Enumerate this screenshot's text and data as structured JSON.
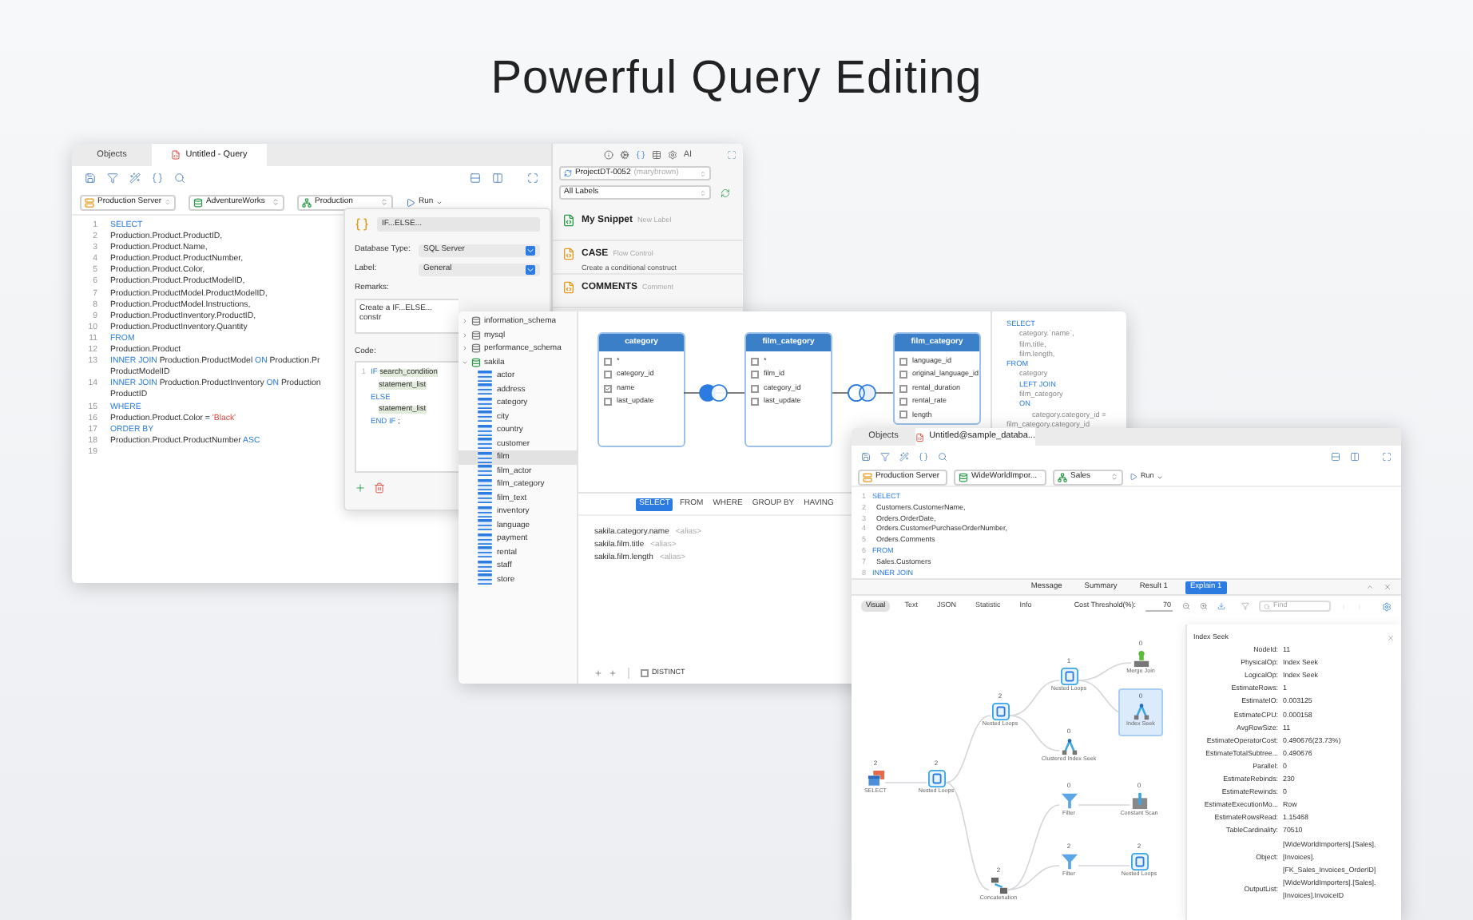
{
  "headline": "Powerful Query Editing",
  "query_window": {
    "tabs": [
      {
        "label": "Objects",
        "kind": "objects",
        "selected": false
      },
      {
        "label": "Untitled - Query",
        "kind": "query",
        "selected": true
      }
    ],
    "connection_selects": [
      {
        "kind": "server",
        "value": "Production Server"
      },
      {
        "kind": "database",
        "value": "AdventureWorks"
      },
      {
        "kind": "schema",
        "value": "Production"
      }
    ],
    "run_button": "Run",
    "code_lines": [
      {
        "number": "1",
        "tokens": [
          {
            "kind": "kw",
            "text": "SELECT"
          }
        ]
      },
      {
        "number": "2",
        "tokens": [
          {
            "kind": "plain",
            "text": "Production.Product.ProductID,"
          }
        ]
      },
      {
        "number": "3",
        "tokens": [
          {
            "kind": "plain",
            "text": "Production.Product.Name,"
          }
        ]
      },
      {
        "number": "4",
        "tokens": [
          {
            "kind": "plain",
            "text": "Production.Product.ProductNumber,"
          }
        ]
      },
      {
        "number": "5",
        "tokens": [
          {
            "kind": "plain",
            "text": "Production.Product.Color,"
          }
        ]
      },
      {
        "number": "6",
        "tokens": [
          {
            "kind": "plain",
            "text": "Production.Product.ProductModelID,"
          }
        ]
      },
      {
        "number": "7",
        "tokens": [
          {
            "kind": "plain",
            "text": "Production.ProductModel.ProductModelID,"
          }
        ]
      },
      {
        "number": "8",
        "tokens": [
          {
            "kind": "plain",
            "text": "Production.ProductModel.Instructions,"
          }
        ]
      },
      {
        "number": "9",
        "tokens": [
          {
            "kind": "plain",
            "text": "Production.ProductInventory.ProductID,"
          }
        ]
      },
      {
        "number": "10",
        "tokens": [
          {
            "kind": "plain",
            "text": "Production.ProductInventory.Quantity"
          }
        ]
      },
      {
        "number": "11",
        "tokens": [
          {
            "kind": "kw",
            "text": "FROM"
          }
        ]
      },
      {
        "number": "12",
        "tokens": [
          {
            "kind": "plain",
            "text": "Production.Product"
          }
        ]
      },
      {
        "number": "13",
        "tokens": [
          {
            "kind": "kw",
            "text": "INNER JOIN"
          },
          {
            "kind": "plain",
            "text": " Production.ProductModel "
          },
          {
            "kind": "kw",
            "text": "ON"
          },
          {
            "kind": "plain",
            "text": " Production.Pr"
          }
        ]
      },
      {
        "tokens": [
          {
            "kind": "plain",
            "text": "ProductModelID"
          }
        ]
      },
      {
        "number": "14",
        "tokens": [
          {
            "kind": "kw",
            "text": "INNER JOIN"
          },
          {
            "kind": "plain",
            "text": " Production.ProductInventory "
          },
          {
            "kind": "kw",
            "text": "ON"
          },
          {
            "kind": "plain",
            "text": " Production"
          }
        ]
      },
      {
        "tokens": [
          {
            "kind": "plain",
            "text": "ProductID"
          }
        ]
      },
      {
        "number": "15",
        "tokens": [
          {
            "kind": "kw",
            "text": "WHERE"
          }
        ]
      },
      {
        "number": "16",
        "tokens": [
          {
            "kind": "plain",
            "text": "Production.Product.Color = "
          },
          {
            "kind": "str",
            "text": "'Black'"
          }
        ]
      },
      {
        "number": "17",
        "tokens": [
          {
            "kind": "kw",
            "text": "ORDER BY"
          }
        ]
      },
      {
        "number": "18",
        "tokens": [
          {
            "kind": "plain",
            "text": "Production.Product.ProductNumber "
          },
          {
            "kind": "kw",
            "text": "ASC"
          }
        ]
      },
      {
        "number": "19"
      }
    ],
    "snippet_editor": {
      "title": "IF...ELSE...",
      "fields": [
        {
          "label": "Database Type:",
          "value": "SQL Server"
        },
        {
          "label": "Label:",
          "value": "General"
        }
      ],
      "remarks_label": "Remarks:",
      "remarks": "Create a IF...ELSE... constr",
      "code_label": "Code:",
      "code_lines": [
        {
          "number": "1",
          "kind": "block",
          "tokens": [
            {
              "kind": "kw",
              "text": "IF "
            },
            {
              "kind": "ph",
              "text": "search_condition"
            }
          ]
        },
        {
          "kind": "nested",
          "tokens": [
            {
              "kind": "ph",
              "text": "statement_list"
            }
          ]
        },
        {
          "kind": "block",
          "tokens": [
            {
              "kind": "kw",
              "text": "ELSE"
            }
          ]
        },
        {
          "kind": "nested",
          "tokens": [
            {
              "kind": "ph",
              "text": "statement_list"
            }
          ]
        },
        {
          "kind": "block",
          "tokens": [
            {
              "kind": "kw",
              "text": "END IF"
            },
            {
              "kind": "plain",
              "text": " ;"
            }
          ]
        }
      ]
    },
    "snippet_panel": {
      "ai_label": "AI",
      "project": "ProjectDT-0052",
      "owner": "(marybrown)",
      "label_filter": "All Labels",
      "snippets": [
        {
          "name": "My Snippet",
          "tag": "New Label",
          "kind": "mine"
        },
        {
          "name": "CASE",
          "tag": "Flow Control",
          "description": "Create a conditional construct",
          "kind": "builtin"
        },
        {
          "name": "COMMENTS",
          "tag": "Comment",
          "kind": "builtin"
        }
      ]
    }
  },
  "query_builder": {
    "tree": [
      {
        "name": "information_schema",
        "expanded": false
      },
      {
        "name": "mysql",
        "expanded": false
      },
      {
        "name": "performance_schema",
        "expanded": false
      },
      {
        "name": "sakila",
        "expanded": true,
        "children": [
          {
            "name": "actor",
            "selected": false
          },
          {
            "name": "address",
            "selected": false
          },
          {
            "name": "category",
            "selected": false
          },
          {
            "name": "city",
            "selected": false
          },
          {
            "name": "country",
            "selected": false
          },
          {
            "name": "customer",
            "selected": false
          },
          {
            "name": "film",
            "selected": true
          },
          {
            "name": "film_actor",
            "selected": false
          },
          {
            "name": "film_category",
            "selected": false
          },
          {
            "name": "film_text",
            "selected": false
          },
          {
            "name": "inventory",
            "selected": false
          },
          {
            "name": "language",
            "selected": false
          },
          {
            "name": "payment",
            "selected": false
          },
          {
            "name": "rental",
            "selected": false
          },
          {
            "name": "staff",
            "selected": false
          },
          {
            "name": "store",
            "selected": false
          }
        ]
      }
    ],
    "tables": [
      {
        "name": "category",
        "columns": [
          {
            "name": "*",
            "checked": false
          },
          {
            "name": "category_id",
            "checked": false
          },
          {
            "name": "name",
            "checked": true
          },
          {
            "name": "last_update",
            "checked": false
          }
        ]
      },
      {
        "name": "film_category",
        "columns": [
          {
            "name": "*",
            "checked": false
          },
          {
            "name": "film_id",
            "checked": false
          },
          {
            "name": "category_id",
            "checked": false
          },
          {
            "name": "last_update",
            "checked": false
          }
        ]
      },
      {
        "name": "film_category",
        "columns": [
          {
            "name": "language_id",
            "checked": false
          },
          {
            "name": "original_language_id",
            "checked": false
          },
          {
            "name": "rental_duration",
            "checked": false
          },
          {
            "name": "rental_rate",
            "checked": false
          },
          {
            "name": "length",
            "checked": false
          }
        ]
      }
    ],
    "joins": [
      {
        "kind": "left"
      },
      {
        "kind": "inner"
      }
    ],
    "clause_tabs": [
      {
        "label": "SELECT",
        "selected": true
      },
      {
        "label": "FROM",
        "selected": false
      },
      {
        "label": "WHERE",
        "selected": false
      },
      {
        "label": "GROUP BY",
        "selected": false
      },
      {
        "label": "HAVING",
        "selected": false
      }
    ],
    "fields": [
      {
        "name": "sakila.category.name",
        "alias": "<alias>"
      },
      {
        "name": "sakila.film.title",
        "alias": "<alias>"
      },
      {
        "name": "sakila.film.length",
        "alias": "<alias>"
      }
    ],
    "distinct": {
      "label": "DISTINCT",
      "checked": false
    },
    "sql_preview": [
      {
        "kind": "kw",
        "text": "SELECT"
      },
      {
        "kind": "col",
        "text": "category.`name`,"
      },
      {
        "kind": "col",
        "text": "film.title,"
      },
      {
        "kind": "col",
        "text": "film.length,"
      },
      {
        "kind": "kw",
        "text": "FROM"
      },
      {
        "kind": "col",
        "text": "category"
      },
      {
        "kind": "kwi",
        "text": "LEFT JOIN"
      },
      {
        "kind": "col",
        "text": "film_category"
      },
      {
        "kind": "kwi",
        "text": "ON"
      },
      {
        "kind": "cond",
        "text": "category.category_id = film_category.category_id"
      }
    ]
  },
  "explain_window": {
    "tabs": [
      {
        "label": "Objects",
        "kind": "objects",
        "selected": false
      },
      {
        "label": "Untitled@sample_databa...",
        "kind": "query",
        "selected": true
      }
    ],
    "connection_selects": [
      {
        "kind": "server",
        "value": "Production Server"
      },
      {
        "kind": "database",
        "value": "WideWorldImpor..."
      },
      {
        "kind": "schema",
        "value": "Sales"
      }
    ],
    "run_button": "Run",
    "code_lines": [
      {
        "number": "1",
        "tokens": [
          {
            "kind": "kw",
            "text": "SELECT"
          }
        ]
      },
      {
        "number": "2",
        "tokens": [
          {
            "kind": "plain",
            "text": "  Customers.CustomerName,"
          }
        ]
      },
      {
        "number": "3",
        "tokens": [
          {
            "kind": "plain",
            "text": "  Orders.OrderDate,"
          }
        ]
      },
      {
        "number": "4",
        "tokens": [
          {
            "kind": "plain",
            "text": "  Orders.CustomerPurchaseOrderNumber,"
          }
        ]
      },
      {
        "number": "5",
        "tokens": [
          {
            "kind": "plain",
            "text": "  Orders.Comments"
          }
        ]
      },
      {
        "number": "6",
        "tokens": [
          {
            "kind": "kw",
            "text": "FROM"
          }
        ]
      },
      {
        "number": "7",
        "tokens": [
          {
            "kind": "plain",
            "text": "  Sales.Customers"
          }
        ]
      },
      {
        "number": "8",
        "tokens": [
          {
            "kind": "kw",
            "text": "INNER JOIN"
          }
        ]
      }
    ],
    "result_tabs": [
      {
        "label": "Message",
        "selected": false
      },
      {
        "label": "Summary",
        "selected": false
      },
      {
        "label": "Result 1",
        "selected": false
      },
      {
        "label": "Explain 1",
        "selected": true
      }
    ],
    "view_tabs": [
      {
        "label": "Visual",
        "selected": true
      },
      {
        "label": "Text",
        "selected": false
      },
      {
        "label": "JSON",
        "selected": false
      },
      {
        "label": "Statistic",
        "selected": false
      },
      {
        "label": "Info",
        "selected": false
      }
    ],
    "cost_threshold": {
      "label": "Cost Threshold(%):",
      "value": "70"
    },
    "find": {
      "placeholder": "Find"
    },
    "plan_nodes": [
      {
        "name": "SELECT",
        "cost": "2",
        "kind": "select",
        "selected": false
      },
      {
        "name": "Nested Loops",
        "cost": "2",
        "kind": "loop",
        "selected": false
      },
      {
        "name": "Nested Loops",
        "cost": "2",
        "kind": "loop",
        "selected": false
      },
      {
        "name": "Nested Loops",
        "cost": "1",
        "kind": "loop",
        "selected": false
      },
      {
        "name": "Merge Join",
        "cost": "0",
        "kind": "merge",
        "selected": false
      },
      {
        "name": "Index Seek",
        "cost": "0",
        "kind": "seek",
        "selected": true
      },
      {
        "name": "Clustered Index Seek",
        "cost": "0",
        "kind": "seek",
        "selected": false
      },
      {
        "name": "Filter",
        "cost": "0",
        "kind": "filter",
        "selected": false
      },
      {
        "name": "Constant Scan",
        "cost": "0",
        "kind": "scan",
        "selected": false
      },
      {
        "name": "Filter",
        "cost": "2",
        "kind": "filter",
        "selected": false
      },
      {
        "name": "Nested Loops",
        "cost": "2",
        "kind": "loop",
        "selected": false
      },
      {
        "name": "Concatenation",
        "cost": "2",
        "kind": "concat",
        "selected": false
      }
    ],
    "properties": {
      "title": "Index Seek",
      "rows": [
        {
          "key": "NodeId:",
          "value": "11"
        },
        {
          "key": "PhysicalOp:",
          "value": "Index Seek"
        },
        {
          "key": "LogicalOp:",
          "value": "Index Seek"
        },
        {
          "key": "EstimateRows:",
          "value": "1"
        },
        {
          "key": "EstimateIO:",
          "value": "0.003125"
        },
        {
          "key": "EstimateCPU:",
          "value": "0.000158"
        },
        {
          "key": "AvgRowSize:",
          "value": "11"
        },
        {
          "key": "EstimateOperatorCost:",
          "value": "0.490676(23.73%)"
        },
        {
          "key": "EstimateTotalSubtree...",
          "value": "0.490676"
        },
        {
          "key": "Parallel:",
          "value": "0"
        },
        {
          "key": "EstimateRebinds:",
          "value": "230"
        },
        {
          "key": "EstimateRewinds:",
          "value": "0"
        },
        {
          "key": "EstimateExecutionMo...",
          "value": "Row"
        },
        {
          "key": "EstimateRowsRead:",
          "value": "1.15468"
        },
        {
          "key": "TableCardinality:",
          "value": "70510"
        },
        {
          "key": "Object:",
          "value": "[WideWorldImporters].[Sales].[Invoices].[FK_Sales_Invoices_OrderID]"
        },
        {
          "key": "OutputList:",
          "value": "[WideWorldImporters].[Sales].[Invoices].InvoiceID"
        }
      ]
    }
  }
}
